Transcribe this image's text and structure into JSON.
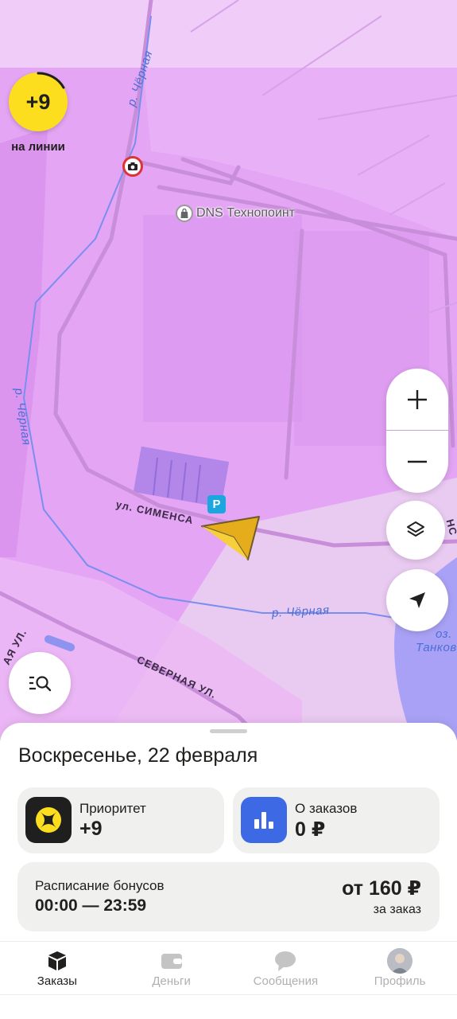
{
  "map": {
    "priority_badge": {
      "value": "+9",
      "caption": "на линии"
    },
    "labels": {
      "river_top": "р. Чёрная",
      "river_left": "р. Чёрная",
      "river_bottom": "р. Чёрная",
      "street_siemens": "ул. СИМЕНСА",
      "street_severnaya": "СЕВЕРНАЯ УЛ.",
      "street_left_partial": "АЯ УЛ.",
      "lake_1": "оз.",
      "lake_2": "Танково",
      "edge_right": "НС"
    },
    "poi": {
      "name": "DNS Технопоинт",
      "icon": "shopping-bag-icon"
    },
    "parking_label": "P",
    "colors": {
      "map_bg": "#e3a5f4",
      "accent": "#fcde1f",
      "water": "#a9a1f5"
    }
  },
  "sheet": {
    "date": "Воскресенье, 22 февраля",
    "priority_card": {
      "label": "Приоритет",
      "value": "+9",
      "icon": "priority-star-icon"
    },
    "orders_card": {
      "label": "О заказов",
      "value": "0 ₽",
      "icon": "bar-chart-icon"
    },
    "bonus_card": {
      "title": "Расписание бонусов",
      "time": "00:00 — 23:59",
      "amount": "от 160 ₽",
      "per": "за заказ"
    }
  },
  "tabs": [
    {
      "label": "Заказы",
      "icon": "orders-box-icon",
      "active": true
    },
    {
      "label": "Деньги",
      "icon": "wallet-icon",
      "active": false
    },
    {
      "label": "Сообщения",
      "icon": "chat-bubble-icon",
      "active": false
    },
    {
      "label": "Профиль",
      "icon": "avatar",
      "active": false
    }
  ]
}
